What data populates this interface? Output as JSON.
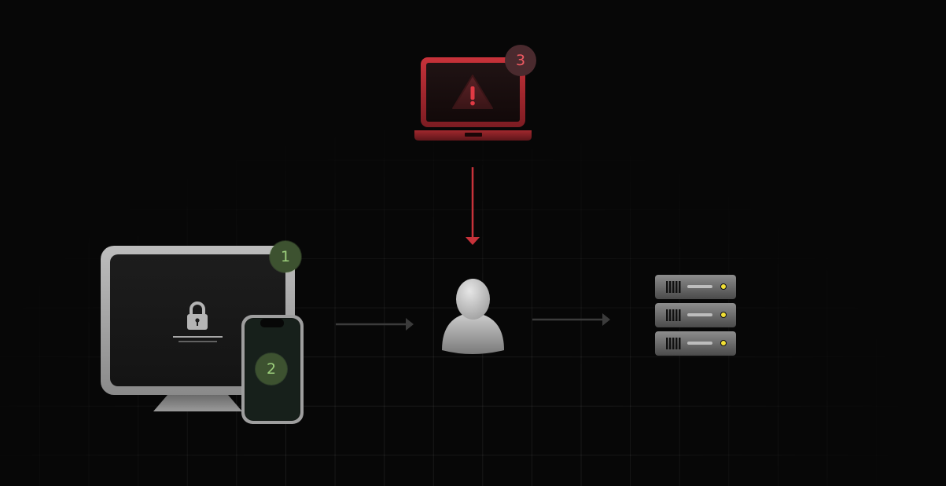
{
  "diagram": {
    "steps": [
      {
        "number": "1",
        "device": "desktop-monitor",
        "state": "locked",
        "color": "#3d5230"
      },
      {
        "number": "2",
        "device": "mobile-phone",
        "color": "#3d5230"
      },
      {
        "number": "3",
        "device": "laptop",
        "state": "warning",
        "color": "#4a2a2e"
      }
    ],
    "nodes": [
      "lock-icon",
      "user-icon",
      "server-icon",
      "warning-icon"
    ],
    "colors": {
      "background": "#070707",
      "alert_red": "#c8323a",
      "success_green": "#9ccf7c",
      "connector_gray": "#3b3b3b"
    }
  }
}
